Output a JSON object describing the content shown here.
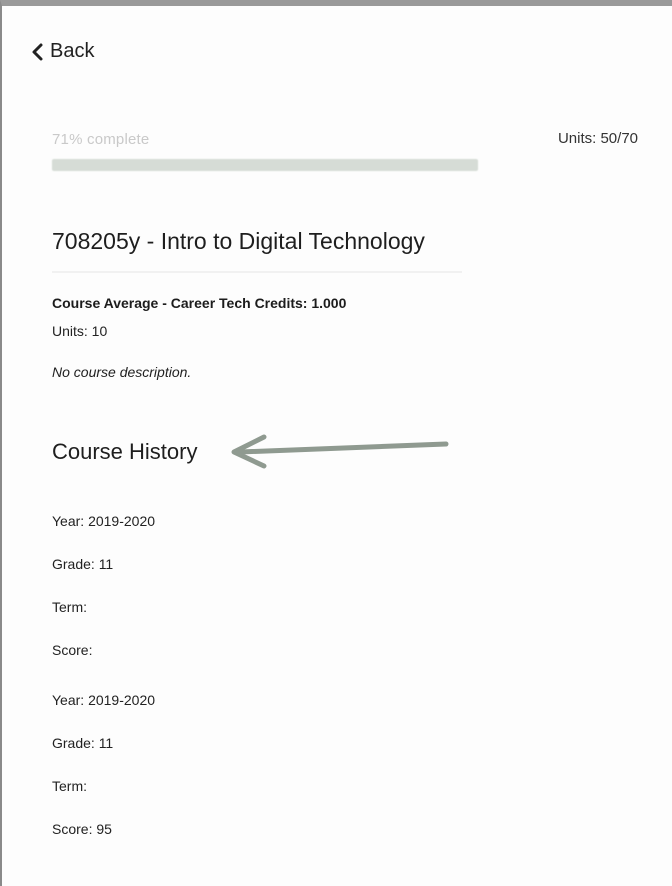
{
  "nav": {
    "back_label": "Back"
  },
  "progress": {
    "label": "71% complete",
    "fraction": 0.71,
    "units_total": "Units: 50/70"
  },
  "course": {
    "title": "708205y - Intro to Digital Technology",
    "average": "Course Average - Career Tech Credits: 1.000",
    "units": "Units: 10",
    "description": "No course description."
  },
  "history": {
    "heading": "Course History",
    "entries": [
      {
        "year": "Year: 2019-2020",
        "grade": "Grade: 11",
        "term": "Term:",
        "score": "Score:"
      },
      {
        "year": "Year: 2019-2020",
        "grade": "Grade: 11",
        "term": "Term:",
        "score": "Score: 95"
      }
    ]
  },
  "colors": {
    "progress_fill": "#d6dcd6",
    "arrow": "#8f9a90",
    "text": "#1f1f1f"
  },
  "icons": {
    "back": "chevron-left-icon",
    "annotation": "arrow-left-icon"
  }
}
